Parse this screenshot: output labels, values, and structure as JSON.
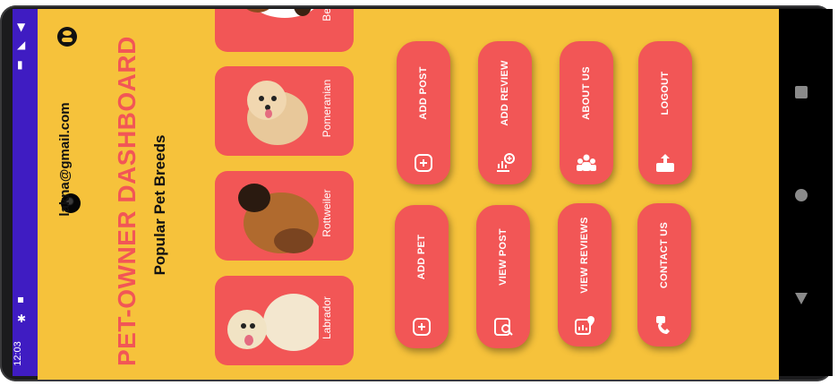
{
  "status_bar": {
    "time": "12:03"
  },
  "header": {
    "title": "PET-OWNER DASHBOARD",
    "subtitle": "Popular Pet Breeds",
    "email": "lakna@gmail.com"
  },
  "breeds": [
    {
      "name": "Beagle"
    },
    {
      "name": "Pomeranian"
    },
    {
      "name": "Rottweiler"
    },
    {
      "name": "Labrador"
    }
  ],
  "actions_top": [
    {
      "label": "ADD POST",
      "icon": "add-square-icon"
    },
    {
      "label": "ADD REVIEW",
      "icon": "chart-add-icon"
    },
    {
      "label": "ABOUT US",
      "icon": "group-icon"
    },
    {
      "label": "LOGOUT",
      "icon": "upload-tray-icon"
    }
  ],
  "actions_bottom": [
    {
      "label": "ADD PET",
      "icon": "add-square-icon"
    },
    {
      "label": "VIEW POST",
      "icon": "search-doc-icon"
    },
    {
      "label": "VIEW REVIEWS",
      "icon": "chart-location-icon"
    },
    {
      "label": "CONTACT US",
      "icon": "phone-chat-icon"
    }
  ],
  "colors": {
    "background": "#f6c23b",
    "accent": "#f25656",
    "status_bar": "#3f1cc2"
  }
}
